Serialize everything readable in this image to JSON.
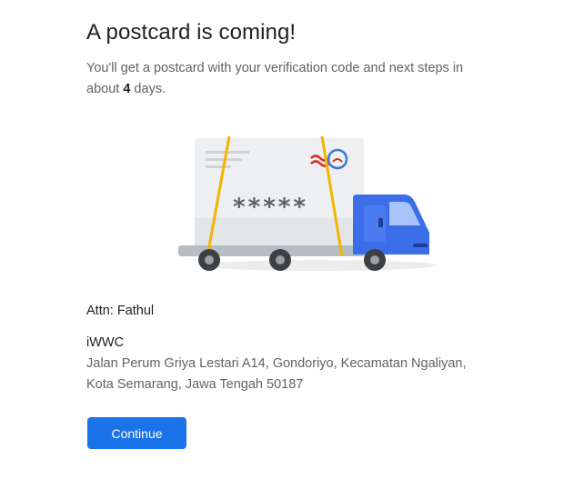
{
  "header": {
    "title": "A postcard is coming!",
    "subtitle_prefix": "You'll get a postcard with your verification code and next steps in about ",
    "days": "4",
    "subtitle_suffix": " days."
  },
  "illustration": {
    "masked_code": "*****",
    "truck_color": "#3b6ee8",
    "stamp_color": "#3c78d8",
    "postmark_color": "#d93025",
    "strap_color": "#f4b400"
  },
  "recipient": {
    "attn": "Attn: Fathul",
    "business_name": "iWWC",
    "address": "Jalan Perum Griya Lestari A14, Gondoriyo, Kecamatan Ngaliyan, Kota Semarang, Jawa Tengah 50187"
  },
  "actions": {
    "continue_label": "Continue",
    "continue_color": "#1a73e8"
  }
}
